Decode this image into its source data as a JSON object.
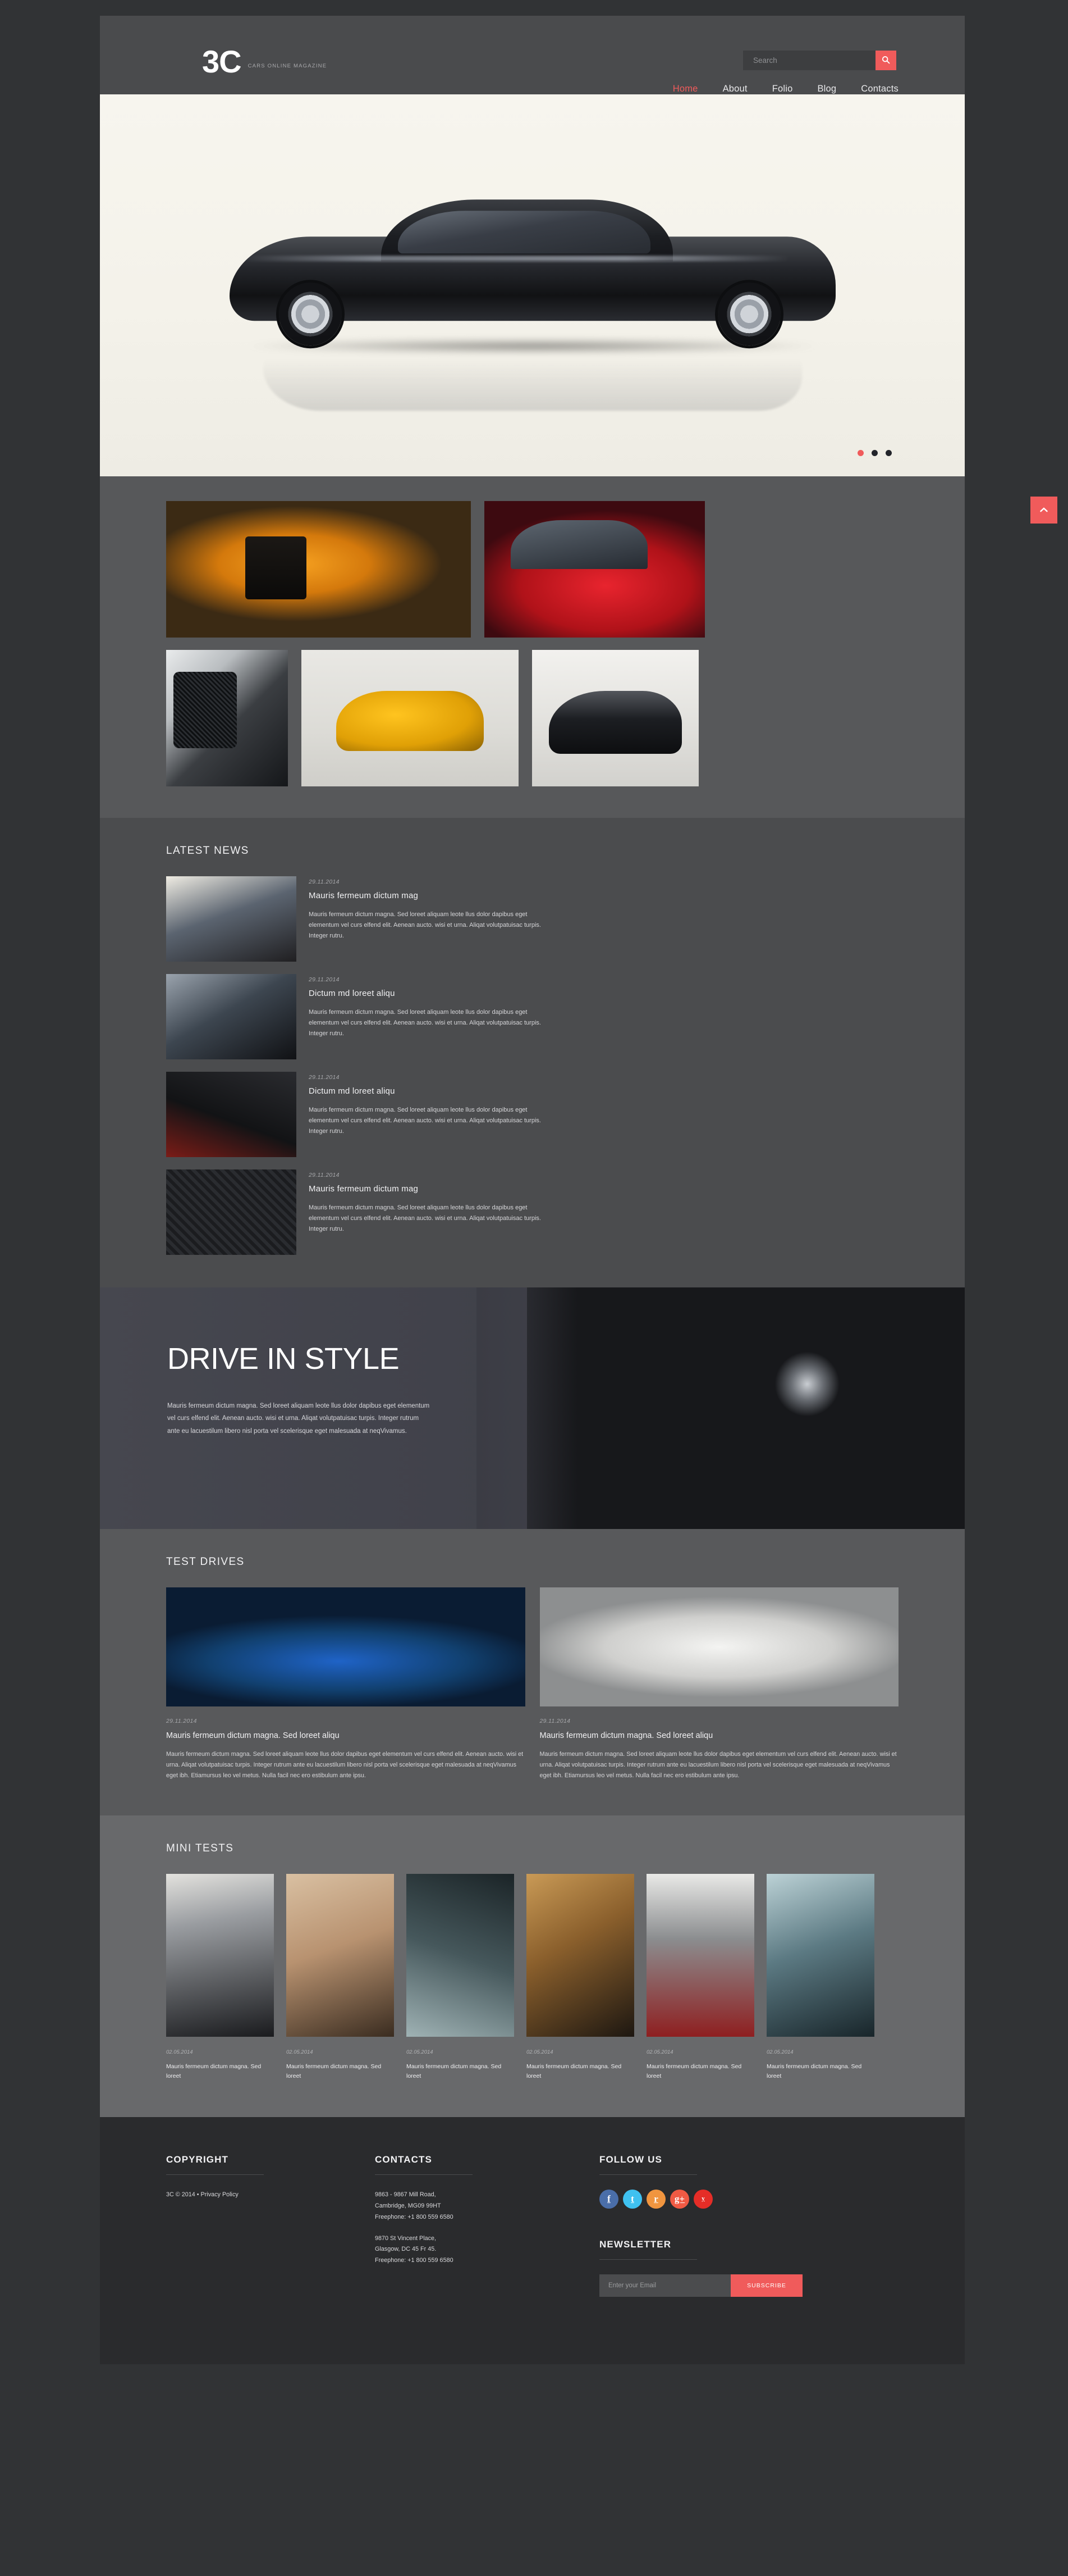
{
  "colors": {
    "accent": "#f05b5b",
    "page_bg": "#313335",
    "header_bg": "#4a4b4d",
    "gallery_bg": "#57585a",
    "news_bg": "#4b4c4e",
    "tests_bg": "#58595b",
    "mini_bg": "#68696b",
    "footer_bg": "#2a2b2d"
  },
  "header": {
    "logo": "3C",
    "tagline": "CARS ONLINE MAGAZINE",
    "search": {
      "placeholder": "Search",
      "value": "",
      "icon": "search-icon"
    },
    "nav": [
      {
        "label": "Home",
        "active": true
      },
      {
        "label": "About",
        "active": false
      },
      {
        "label": "Folio",
        "active": false
      },
      {
        "label": "Blog",
        "active": false
      },
      {
        "label": "Contacts",
        "active": false
      }
    ]
  },
  "slider": {
    "dots": [
      {
        "active": true
      },
      {
        "active": false
      },
      {
        "active": false
      }
    ]
  },
  "gallery": {
    "row1": [
      {
        "name": "orange-supercar-rear",
        "class": "img-orange"
      },
      {
        "name": "red-coupe-side",
        "class": "img-red"
      }
    ],
    "row2": [
      {
        "name": "grille-closeup",
        "class": "img-grille"
      },
      {
        "name": "yellow-hatchback",
        "class": "img-yellow"
      },
      {
        "name": "black-sedan-front",
        "class": "img-black"
      }
    ]
  },
  "news": {
    "title": "LATEST NEWS",
    "items": [
      {
        "date": "29.11.2014",
        "title": "Mauris fermeum dictum mag",
        "text": "Mauris fermeum dictum magna. Sed loreet aliquam leote llus dolor dapibus eget elementum vel curs elfend elit. Aenean aucto. wisi et urna. Aliqat volutpatuisac turpis. Integer rutru.",
        "thumb": "nt-a"
      },
      {
        "date": "29.11.2014",
        "title": "Dictum md loreet aliqu",
        "text": "Mauris fermeum dictum magna. Sed loreet aliquam leote llus dolor dapibus eget elementum vel curs elfend elit. Aenean aucto. wisi et urna. Aliqat volutpatuisac turpis. Integer rutru.",
        "thumb": "nt-b"
      },
      {
        "date": "29.11.2014",
        "title": "Dictum md loreet aliqu",
        "text": "Mauris fermeum dictum magna. Sed loreet aliquam leote llus dolor dapibus eget elementum vel curs elfend elit. Aenean aucto. wisi et urna. Aliqat volutpatuisac turpis. Integer rutru.",
        "thumb": "nt-c"
      },
      {
        "date": "29.11.2014",
        "title": "Mauris fermeum dictum mag",
        "text": "Mauris fermeum dictum magna. Sed loreet aliquam leote llus dolor dapibus eget elementum vel curs elfend elit. Aenean aucto. wisi et urna. Aliqat volutpatuisac turpis. Integer rutru.",
        "thumb": "nt-d"
      }
    ]
  },
  "promo": {
    "title": "DRIVE IN STYLE",
    "text": "Mauris fermeum dictum magna. Sed loreet aliquam leote llus dolor dapibus eget elementum vel curs elfend elit. Aenean aucto. wisi et urna. Aliqat volutpatuisac turpis. Integer rutrum ante eu lacuestilum libero nisl porta vel scelerisque eget malesuada at neqVivamus."
  },
  "tests": {
    "title": "TEST DRIVES",
    "items": [
      {
        "date": "29.11.2014",
        "title": "Mauris fermeum dictum magna. Sed loreet aliqu",
        "text": "Mauris fermeum dictum magna. Sed loreet aliquam leote llus dolor dapibus eget elementum vel curs elfend elit. Aenean aucto. wisi et urna. Aliqat volutpatuisac turpis. Integer rutrum ante eu lacuestilum libero nisl porta vel scelerisque eget malesuada at neqVivamus eget ibh. Etiamursus leo vel metus. Nulla facil nec ero estibulum ante ipsu.",
        "img": "ti-blue"
      },
      {
        "date": "29.11.2014",
        "title": "Mauris fermeum dictum magna. Sed loreet aliqu",
        "text": "Mauris fermeum dictum magna. Sed loreet aliquam leote llus dolor dapibus eget elementum vel curs elfend elit. Aenean aucto. wisi et urna. Aliqat volutpatuisac turpis. Integer rutrum ante eu lacuestilum libero nisl porta vel scelerisque eget malesuada at neqVivamus eget ibh. Etiamursus leo vel metus. Nulla facil nec ero estibulum ante ipsu.",
        "img": "ti-white"
      }
    ]
  },
  "mini": {
    "title": "MINI TESTS",
    "items": [
      {
        "date": "02.05.2014",
        "text": "Mauris fermeum dictum magna. Sed loreet",
        "img": "mi1"
      },
      {
        "date": "02.05.2014",
        "text": "Mauris fermeum dictum magna. Sed loreet",
        "img": "mi2"
      },
      {
        "date": "02.05.2014",
        "text": "Mauris fermeum dictum magna. Sed loreet",
        "img": "mi3"
      },
      {
        "date": "02.05.2014",
        "text": "Mauris fermeum dictum magna. Sed loreet",
        "img": "mi4"
      },
      {
        "date": "02.05.2014",
        "text": "Mauris fermeum dictum magna. Sed loreet",
        "img": "mi5"
      },
      {
        "date": "02.05.2014",
        "text": "Mauris fermeum dictum magna. Sed loreet",
        "img": "mi6"
      }
    ]
  },
  "footer": {
    "copyright": {
      "heading": "COPYRIGHT",
      "text": "3C © 2014 • Privacy Policy"
    },
    "contacts": {
      "heading": "CONTACTS",
      "address1": "9863 - 9867 Mill Road,\nCambridge, MG09 99HT\nFreephone: +1 800 559 6580",
      "address2": "9870 St Vincent Place,\nGlasgow, DC 45 Fr 45.\nFreephone: +1 800 559 6580"
    },
    "follow": {
      "heading": "FOLLOW US",
      "socials": [
        {
          "name": "facebook-icon",
          "glyph": "f",
          "color": "#4a6ea9"
        },
        {
          "name": "twitter-icon",
          "glyph": "t",
          "color": "#3fc1f0"
        },
        {
          "name": "rss-icon",
          "glyph": "r",
          "color": "#f0953f"
        },
        {
          "name": "google-plus-icon",
          "glyph": "g+",
          "color": "#f05a44"
        },
        {
          "name": "youtube-icon",
          "glyph": "y",
          "color": "#e52d27"
        }
      ]
    },
    "newsletter": {
      "heading": "NEWSLETTER",
      "placeholder": "Enter your Email",
      "value": "",
      "button": "SUBSCRIBE"
    }
  },
  "scroll_top": {
    "icon": "chevron-up-icon"
  }
}
